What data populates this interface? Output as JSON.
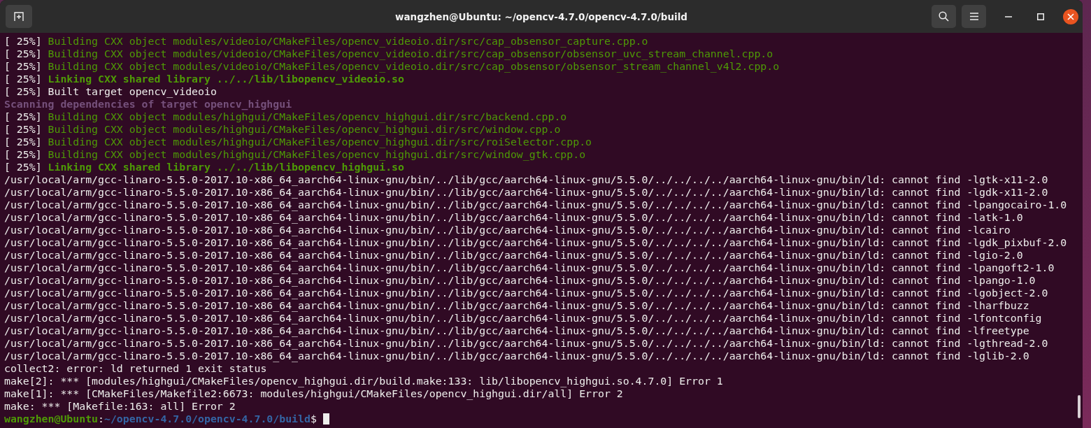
{
  "window": {
    "title": "wangzhen@Ubuntu: ~/opencv-4.7.0/opencv-4.7.0/build"
  },
  "terminal": {
    "lines": [
      {
        "segments": [
          {
            "kind": "plain",
            "text": "[ 25%] "
          },
          {
            "kind": "build",
            "text": "Building CXX object modules/videoio/CMakeFiles/opencv_videoio.dir/src/cap_obsensor_capture.cpp.o"
          }
        ]
      },
      {
        "segments": [
          {
            "kind": "plain",
            "text": "[ 25%] "
          },
          {
            "kind": "build",
            "text": "Building CXX object modules/videoio/CMakeFiles/opencv_videoio.dir/src/cap_obsensor/obsensor_uvc_stream_channel.cpp.o"
          }
        ]
      },
      {
        "segments": [
          {
            "kind": "plain",
            "text": "[ 25%] "
          },
          {
            "kind": "build",
            "text": "Building CXX object modules/videoio/CMakeFiles/opencv_videoio.dir/src/cap_obsensor/obsensor_stream_channel_v4l2.cpp.o"
          }
        ]
      },
      {
        "segments": [
          {
            "kind": "plain",
            "text": "[ 25%] "
          },
          {
            "kind": "link",
            "text": "Linking CXX shared library ../../lib/libopencv_videoio.so"
          }
        ]
      },
      {
        "segments": [
          {
            "kind": "plain",
            "text": "[ 25%] Built target opencv_videoio"
          }
        ]
      },
      {
        "segments": [
          {
            "kind": "scan",
            "text": "Scanning dependencies of target opencv_highgui"
          }
        ]
      },
      {
        "segments": [
          {
            "kind": "plain",
            "text": "[ 25%] "
          },
          {
            "kind": "build",
            "text": "Building CXX object modules/highgui/CMakeFiles/opencv_highgui.dir/src/backend.cpp.o"
          }
        ]
      },
      {
        "segments": [
          {
            "kind": "plain",
            "text": "[ 25%] "
          },
          {
            "kind": "build",
            "text": "Building CXX object modules/highgui/CMakeFiles/opencv_highgui.dir/src/window.cpp.o"
          }
        ]
      },
      {
        "segments": [
          {
            "kind": "plain",
            "text": "[ 25%] "
          },
          {
            "kind": "build",
            "text": "Building CXX object modules/highgui/CMakeFiles/opencv_highgui.dir/src/roiSelector.cpp.o"
          }
        ]
      },
      {
        "segments": [
          {
            "kind": "plain",
            "text": "[ 25%] "
          },
          {
            "kind": "build",
            "text": "Building CXX object modules/highgui/CMakeFiles/opencv_highgui.dir/src/window_gtk.cpp.o"
          }
        ]
      },
      {
        "segments": [
          {
            "kind": "plain",
            "text": "[ 25%] "
          },
          {
            "kind": "link",
            "text": "Linking CXX shared library ../../lib/libopencv_highgui.so"
          }
        ]
      },
      {
        "segments": [
          {
            "kind": "plain",
            "text": "/usr/local/arm/gcc-linaro-5.5.0-2017.10-x86_64_aarch64-linux-gnu/bin/../lib/gcc/aarch64-linux-gnu/5.5.0/../../../../aarch64-linux-gnu/bin/ld: cannot find -lgtk-x11-2.0"
          }
        ]
      },
      {
        "segments": [
          {
            "kind": "plain",
            "text": "/usr/local/arm/gcc-linaro-5.5.0-2017.10-x86_64_aarch64-linux-gnu/bin/../lib/gcc/aarch64-linux-gnu/5.5.0/../../../../aarch64-linux-gnu/bin/ld: cannot find -lgdk-x11-2.0"
          }
        ]
      },
      {
        "segments": [
          {
            "kind": "plain",
            "text": "/usr/local/arm/gcc-linaro-5.5.0-2017.10-x86_64_aarch64-linux-gnu/bin/../lib/gcc/aarch64-linux-gnu/5.5.0/../../../../aarch64-linux-gnu/bin/ld: cannot find -lpangocairo-1.0"
          }
        ]
      },
      {
        "segments": [
          {
            "kind": "plain",
            "text": "/usr/local/arm/gcc-linaro-5.5.0-2017.10-x86_64_aarch64-linux-gnu/bin/../lib/gcc/aarch64-linux-gnu/5.5.0/../../../../aarch64-linux-gnu/bin/ld: cannot find -latk-1.0"
          }
        ]
      },
      {
        "segments": [
          {
            "kind": "plain",
            "text": "/usr/local/arm/gcc-linaro-5.5.0-2017.10-x86_64_aarch64-linux-gnu/bin/../lib/gcc/aarch64-linux-gnu/5.5.0/../../../../aarch64-linux-gnu/bin/ld: cannot find -lcairo"
          }
        ]
      },
      {
        "segments": [
          {
            "kind": "plain",
            "text": "/usr/local/arm/gcc-linaro-5.5.0-2017.10-x86_64_aarch64-linux-gnu/bin/../lib/gcc/aarch64-linux-gnu/5.5.0/../../../../aarch64-linux-gnu/bin/ld: cannot find -lgdk_pixbuf-2.0"
          }
        ]
      },
      {
        "segments": [
          {
            "kind": "plain",
            "text": "/usr/local/arm/gcc-linaro-5.5.0-2017.10-x86_64_aarch64-linux-gnu/bin/../lib/gcc/aarch64-linux-gnu/5.5.0/../../../../aarch64-linux-gnu/bin/ld: cannot find -lgio-2.0"
          }
        ]
      },
      {
        "segments": [
          {
            "kind": "plain",
            "text": "/usr/local/arm/gcc-linaro-5.5.0-2017.10-x86_64_aarch64-linux-gnu/bin/../lib/gcc/aarch64-linux-gnu/5.5.0/../../../../aarch64-linux-gnu/bin/ld: cannot find -lpangoft2-1.0"
          }
        ]
      },
      {
        "segments": [
          {
            "kind": "plain",
            "text": "/usr/local/arm/gcc-linaro-5.5.0-2017.10-x86_64_aarch64-linux-gnu/bin/../lib/gcc/aarch64-linux-gnu/5.5.0/../../../../aarch64-linux-gnu/bin/ld: cannot find -lpango-1.0"
          }
        ]
      },
      {
        "segments": [
          {
            "kind": "plain",
            "text": "/usr/local/arm/gcc-linaro-5.5.0-2017.10-x86_64_aarch64-linux-gnu/bin/../lib/gcc/aarch64-linux-gnu/5.5.0/../../../../aarch64-linux-gnu/bin/ld: cannot find -lgobject-2.0"
          }
        ]
      },
      {
        "segments": [
          {
            "kind": "plain",
            "text": "/usr/local/arm/gcc-linaro-5.5.0-2017.10-x86_64_aarch64-linux-gnu/bin/../lib/gcc/aarch64-linux-gnu/5.5.0/../../../../aarch64-linux-gnu/bin/ld: cannot find -lharfbuzz"
          }
        ]
      },
      {
        "segments": [
          {
            "kind": "plain",
            "text": "/usr/local/arm/gcc-linaro-5.5.0-2017.10-x86_64_aarch64-linux-gnu/bin/../lib/gcc/aarch64-linux-gnu/5.5.0/../../../../aarch64-linux-gnu/bin/ld: cannot find -lfontconfig"
          }
        ]
      },
      {
        "segments": [
          {
            "kind": "plain",
            "text": "/usr/local/arm/gcc-linaro-5.5.0-2017.10-x86_64_aarch64-linux-gnu/bin/../lib/gcc/aarch64-linux-gnu/5.5.0/../../../../aarch64-linux-gnu/bin/ld: cannot find -lfreetype"
          }
        ]
      },
      {
        "segments": [
          {
            "kind": "plain",
            "text": "/usr/local/arm/gcc-linaro-5.5.0-2017.10-x86_64_aarch64-linux-gnu/bin/../lib/gcc/aarch64-linux-gnu/5.5.0/../../../../aarch64-linux-gnu/bin/ld: cannot find -lgthread-2.0"
          }
        ]
      },
      {
        "segments": [
          {
            "kind": "plain",
            "text": "/usr/local/arm/gcc-linaro-5.5.0-2017.10-x86_64_aarch64-linux-gnu/bin/../lib/gcc/aarch64-linux-gnu/5.5.0/../../../../aarch64-linux-gnu/bin/ld: cannot find -lglib-2.0"
          }
        ]
      },
      {
        "segments": [
          {
            "kind": "plain",
            "text": "collect2: error: ld returned 1 exit status"
          }
        ]
      },
      {
        "segments": [
          {
            "kind": "plain",
            "text": "make[2]: *** [modules/highgui/CMakeFiles/opencv_highgui.dir/build.make:133: lib/libopencv_highgui.so.4.7.0] Error 1"
          }
        ]
      },
      {
        "segments": [
          {
            "kind": "plain",
            "text": "make[1]: *** [CMakeFiles/Makefile2:6673: modules/highgui/CMakeFiles/opencv_highgui.dir/all] Error 2"
          }
        ]
      },
      {
        "segments": [
          {
            "kind": "plain",
            "text": "make: *** [Makefile:163: all] Error 2"
          }
        ]
      }
    ],
    "prompt": {
      "user": "wangzhen@Ubuntu",
      "separator": ":",
      "path": "~/opencv-4.7.0/opencv-4.7.0/build",
      "symbol": "$"
    }
  }
}
